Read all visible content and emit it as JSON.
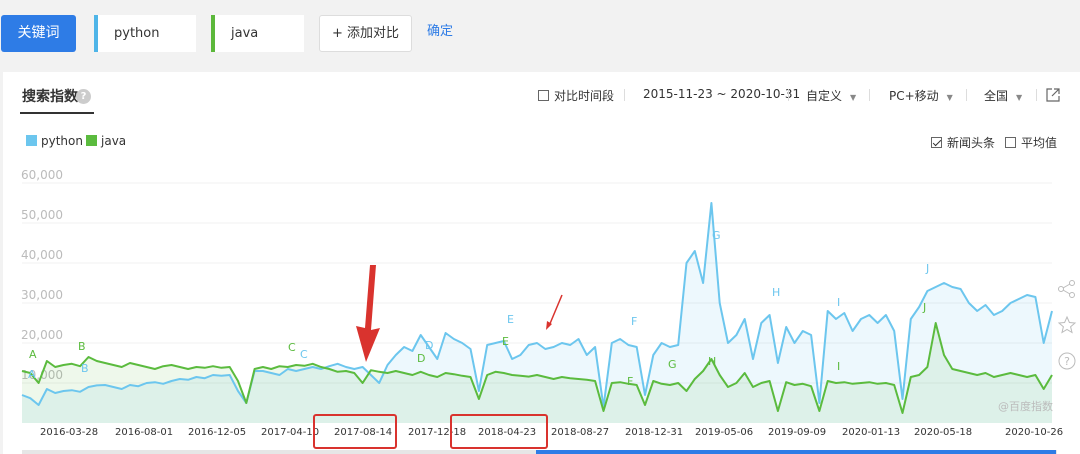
{
  "header": {
    "keyword_label": "关键词",
    "keywords": [
      "python",
      "java"
    ],
    "add_compare_label": "+ 添加对比",
    "confirm_label": "确定"
  },
  "panel": {
    "title": "搜索指数",
    "help": "?",
    "compare_period": "对比时间段",
    "date_range": "2015-11-23 ~ 2020-10-31",
    "custom": "自定义",
    "device": "PC+移动",
    "region": "全国",
    "news_label": "新闻头条",
    "average_label": "平均值",
    "watermark": "@百度指数"
  },
  "colors": {
    "python": "#6cc6ee",
    "java": "#5bbb3e",
    "accent": "#2e7ce6",
    "annotation": "#d9332e"
  },
  "chart_data": {
    "type": "area",
    "title": "",
    "xlabel": "",
    "ylabel": "",
    "ylim": [
      0,
      60000
    ],
    "yticks": [
      "60,000",
      "50,000",
      "40,000",
      "30,000",
      "20,000",
      "10,000"
    ],
    "xticks": [
      "2016-03-28",
      "2016-08-01",
      "2016-12-05",
      "2017-04-10",
      "2017-08-14",
      "2017-12-18",
      "2018-04-23",
      "2018-08-27",
      "2018-12-31",
      "2019-05-06",
      "2019-09-09",
      "2020-01-13",
      "2020-05-18",
      "2020-10-26"
    ],
    "legend": [
      "python",
      "java"
    ],
    "grid": true,
    "series": [
      {
        "name": "python",
        "values": [
          7000,
          6200,
          4500,
          8500,
          7500,
          8000,
          8200,
          7800,
          9000,
          9400,
          9500,
          9000,
          8500,
          9500,
          9200,
          10000,
          10200,
          9800,
          10500,
          11000,
          10800,
          11500,
          11200,
          12000,
          11800,
          12000,
          8000,
          5000,
          13000,
          13000,
          12500,
          12000,
          13500,
          13000,
          13500,
          14000,
          13500,
          14200,
          14800,
          14000,
          13500,
          14000,
          12000,
          10000,
          14500,
          17000,
          19000,
          18000,
          22000,
          19000,
          16000,
          22500,
          21000,
          20000,
          18500,
          8000,
          19500,
          20000,
          20500,
          16000,
          17000,
          19500,
          20000,
          18500,
          19000,
          20000,
          19500,
          21000,
          17000,
          19000,
          4000,
          20000,
          21000,
          19500,
          19000,
          7000,
          17000,
          20000,
          19000,
          19500,
          40000,
          43000,
          35000,
          55000,
          30000,
          20000,
          22000,
          26000,
          16000,
          25000,
          27000,
          15000,
          24000,
          20000,
          23000,
          22000,
          5000,
          28000,
          26000,
          27500,
          23000,
          26000,
          27000,
          25000,
          27000,
          23000,
          6000,
          26000,
          29000,
          33000,
          34000,
          35000,
          34000,
          33500,
          30000,
          28000,
          29500,
          27000,
          28000,
          30000,
          31000,
          32000,
          31500,
          20000,
          28000
        ],
        "labels": [
          "A",
          "B",
          "C",
          "D",
          "E",
          "F",
          "G",
          "H",
          "I",
          "J"
        ]
      },
      {
        "name": "java",
        "values": [
          13000,
          12500,
          10000,
          15500,
          14000,
          14500,
          14800,
          14200,
          16500,
          15500,
          15000,
          14500,
          14000,
          15000,
          14500,
          14000,
          13500,
          14200,
          14500,
          14000,
          13500,
          14000,
          13800,
          14200,
          13800,
          14000,
          10500,
          5000,
          13500,
          14000,
          13500,
          14200,
          14000,
          14500,
          14300,
          14800,
          14000,
          13500,
          12800,
          13000,
          12500,
          10000,
          13200,
          12800,
          12500,
          13000,
          12500,
          12000,
          12800,
          12000,
          11500,
          12500,
          12200,
          11800,
          11500,
          6000,
          12000,
          12800,
          12500,
          12000,
          11800,
          11600,
          12000,
          11500,
          11000,
          11500,
          11200,
          11000,
          10800,
          10500,
          3000,
          10000,
          10200,
          9800,
          9500,
          4500,
          10500,
          9800,
          9500,
          10000,
          8000,
          11000,
          13000,
          16000,
          12000,
          9000,
          10000,
          12500,
          9000,
          10000,
          10500,
          3000,
          10200,
          9500,
          9800,
          9200,
          3000,
          10500,
          10000,
          10200,
          9800,
          10000,
          10200,
          9800,
          10000,
          9500,
          2500,
          11500,
          12000,
          14000,
          25000,
          17000,
          13500,
          13000,
          12500,
          12000,
          12500,
          11500,
          12000,
          12500,
          12000,
          11500,
          12000,
          8500,
          12000
        ],
        "labels": [
          "A",
          "B",
          "C",
          "D",
          "E",
          "F",
          "G",
          "H",
          "I",
          "J"
        ]
      }
    ]
  },
  "annotations": {
    "boxed_dates": [
      "2017-08-14",
      "2018-04-23"
    ]
  }
}
